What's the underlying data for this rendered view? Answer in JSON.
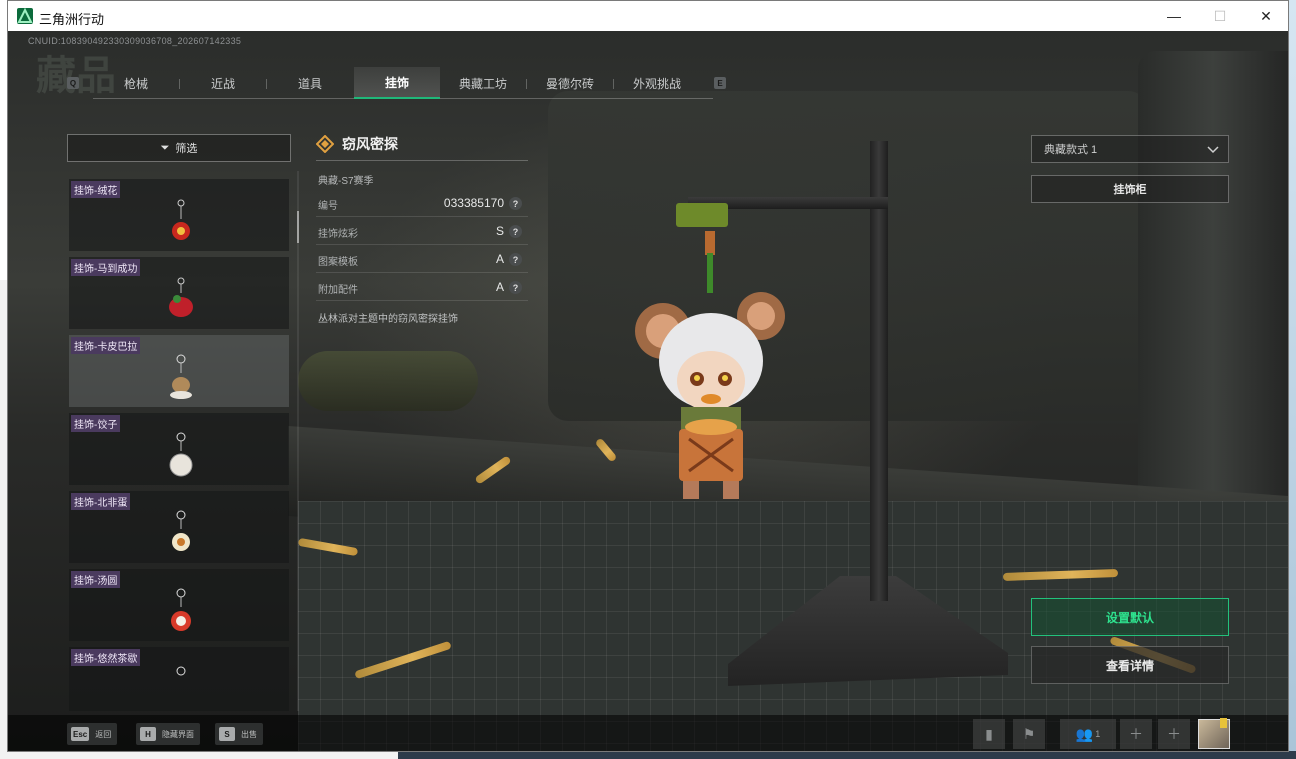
{
  "window": {
    "title": "三角洲行动",
    "minimize": "—",
    "maximize": "☐",
    "close": "✕"
  },
  "uid": "CNUID:1083904923303090367​08_202607142335",
  "nav": {
    "prev_key": "Q",
    "next_key": "E",
    "tabs": [
      "枪械",
      "近战",
      "道具",
      "挂饰",
      "典藏工坊",
      "曼德尔砖",
      "外观挑战"
    ],
    "active_index": 3
  },
  "filter": {
    "label": "筛选",
    "icon": "filter-icon"
  },
  "charm_list": {
    "items": [
      {
        "label": "挂饰-绒花",
        "color": "#c8281e"
      },
      {
        "label": "挂饰-马到成功",
        "color": "#c0202a"
      },
      {
        "label": "挂饰-卡皮巴拉",
        "color": "#b08a5a"
      },
      {
        "label": "挂饰-饺子",
        "color": "#e8e4dc"
      },
      {
        "label": "挂饰-北非蛋",
        "color": "#c8782a"
      },
      {
        "label": "挂饰-汤圆",
        "color": "#d83a2a"
      },
      {
        "label": "挂饰-悠然茶歇",
        "color": "#8a8a8a"
      }
    ],
    "selected_index": 2
  },
  "detail": {
    "name": "窃风密探",
    "season": "典藏-S7赛季",
    "rows": [
      {
        "key": "编号",
        "value": "033385170"
      },
      {
        "key": "挂饰炫彩",
        "value": "S"
      },
      {
        "key": "图案模板",
        "value": "A"
      },
      {
        "key": "附加配件",
        "value": "A"
      }
    ],
    "help": "?",
    "description": "丛林派对主题中的窃风密探挂饰"
  },
  "right_panel": {
    "style_select": "典藏款式 1",
    "cabinet": "挂饰柜",
    "set_default": "设置默认",
    "view_details": "查看详情"
  },
  "bottom_hints": [
    {
      "key": "Esc",
      "label": "返回"
    },
    {
      "key": "H",
      "label": "隐藏界面"
    },
    {
      "key": "S",
      "label": "出售"
    }
  ],
  "bottom_right": {
    "team_count": "1",
    "icons": [
      "stats-icon",
      "flag-icon",
      "team-icon",
      "plus-icon",
      "plus-icon"
    ]
  },
  "colors": {
    "accent": "#22c27c",
    "label_bg": "#4a3a5e"
  }
}
